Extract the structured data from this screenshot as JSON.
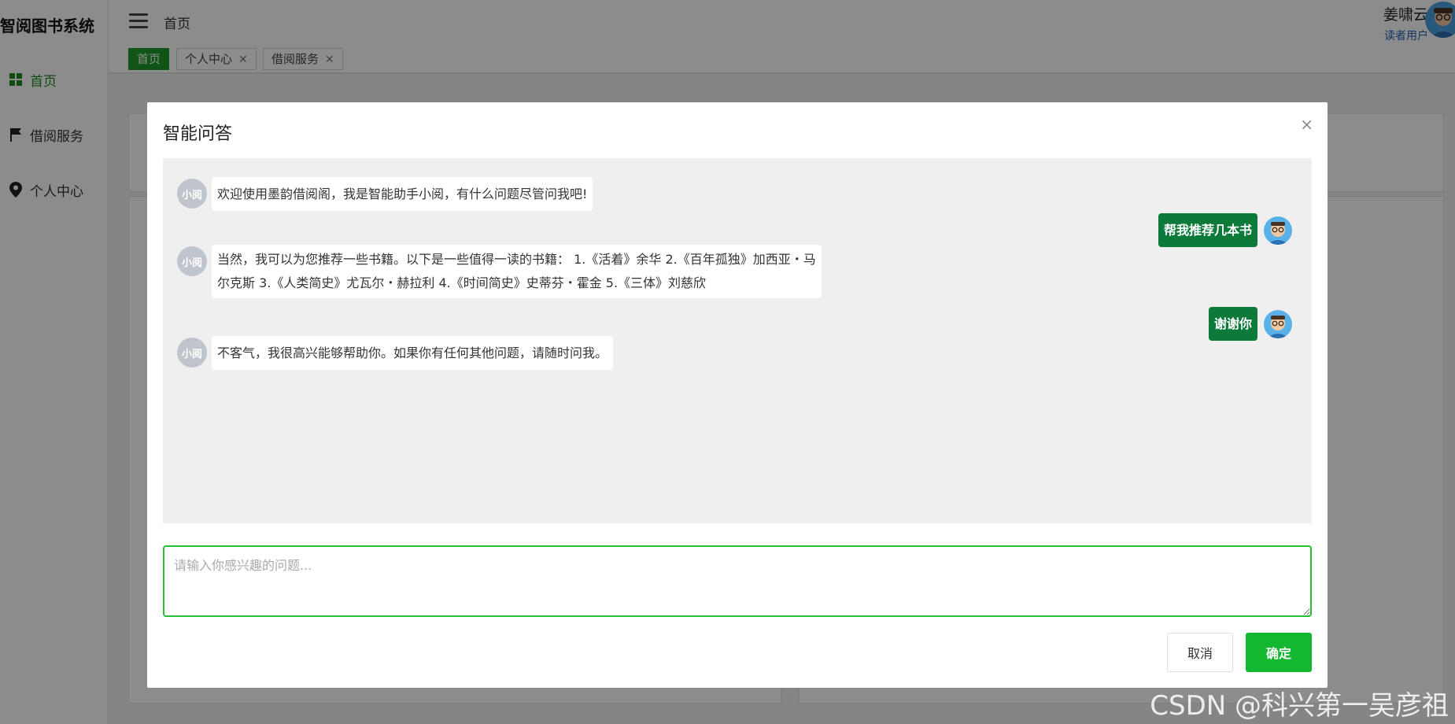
{
  "app": {
    "title": "智阅图书系统"
  },
  "sidebar": {
    "items": [
      {
        "label": "首页",
        "icon": "grid-icon",
        "active": true
      },
      {
        "label": "借阅服务",
        "icon": "flag-icon",
        "active": false
      },
      {
        "label": "个人中心",
        "icon": "location-pin-icon",
        "active": false
      }
    ]
  },
  "header": {
    "breadcrumb": "首页",
    "user_name": "姜啸云",
    "user_role": "读者用户"
  },
  "tabs": [
    {
      "label": "首页",
      "active": true,
      "closable": false
    },
    {
      "label": "个人中心",
      "active": false,
      "closable": true
    },
    {
      "label": "借阅服务",
      "active": false,
      "closable": true
    }
  ],
  "dialog": {
    "title": "智能问答",
    "close_glyph": "×",
    "bot_name": "小阅",
    "messages": [
      {
        "role": "bot",
        "text": "欢迎使用墨韵借阅阁，我是智能助手小阅，有什么问题尽管问我吧!"
      },
      {
        "role": "user",
        "text": "帮我推荐几本书"
      },
      {
        "role": "bot",
        "line1": "当然，我可以为您推荐一些书籍。以下是一些值得一读的书籍： 1.《活着》余华 2.《百年孤独》加西亚・马",
        "line2": "尔克斯 3.《人类简史》尤瓦尔・赫拉利 4.《时间简史》史蒂芬・霍金 5.《三体》刘慈欣"
      },
      {
        "role": "user",
        "text": "谢谢你"
      },
      {
        "role": "bot",
        "text": "不客气，我很高兴能够帮助你。如果你有任何其他问题，请随时问我。"
      }
    ],
    "input_placeholder": "请输入你感兴趣的问题...",
    "input_value": "",
    "cancel_label": "取消",
    "confirm_label": "确定"
  },
  "watermark": "CSDN @科兴第一吴彦祖",
  "colors": {
    "accent": "#1f9a2b",
    "user_bubble": "#0d7a3a",
    "confirm_button": "#14b830",
    "input_border": "#25c035"
  }
}
